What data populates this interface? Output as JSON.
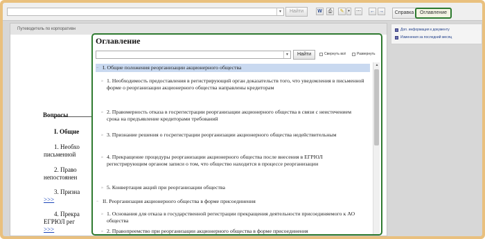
{
  "toolbar": {
    "find_label": "Найти",
    "help_tab": "Справка",
    "contents_tab": "Оглавление"
  },
  "right_panel": {
    "items": [
      "Доп. информация к документу",
      "Изменения за последний месяц"
    ]
  },
  "document": {
    "header": "Путеводитель по корпоративн",
    "fragments": [
      "Вопросы",
      "I. Общие",
      "1. Необхо",
      "письменной",
      "2. Право",
      "непостоянен",
      "3. Призна",
      ">>>",
      "4. Прекра",
      "ЕГРЮЛ рег",
      ">>>"
    ]
  },
  "dialog": {
    "title": "Оглавление",
    "find_label": "Найти",
    "collapse_all": "Свернуть всё",
    "expand_all": "Развернуть",
    "sections": [
      "I. Общие положения реорганизации акционерного общества",
      "II. Реорганизация акционерного общества в форме присоединения"
    ],
    "items": [
      "1. Необходимость предоставления в регистрирующий орган доказательств того, что уведомления в письменной форме о реорганизации акционерного общества направлены кредиторам",
      "2. Правомерность отказа в госрегистрации реорганизации акционерного общества в связи с неистечением срока на предъявление кредиторами требований",
      "3. Признание решения о госрегистрации реорганизации акционерного общества недействительным",
      "4. Прекращение процедуры реорганизации акционерного общества после внесения в ЕГРЮЛ регистрирующим органом записи о том, что общество находится в процессе реорганизации",
      "5. Конвертация акций при реорганизации общества",
      "1. Основания для отказа в государственной регистрации прекращения деятельности присоединяемого к АО общества",
      "2. Правопреемство при реорганизации акционерного общества в форме присоединения"
    ]
  }
}
